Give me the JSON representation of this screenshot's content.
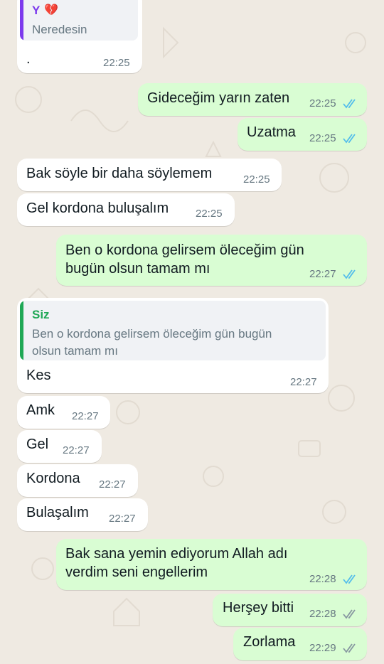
{
  "colors": {
    "chat_bg": "#efeae2",
    "incoming": "#ffffff",
    "outgoing": "#d9fdd3",
    "read_ticks": "#53bdeb",
    "delivered_ticks": "#8696a0",
    "quote_author_first": "#7c3aed",
    "quote_author_siz": "#1fa855"
  },
  "messages": [
    {
      "dir": "in",
      "quote": {
        "author": "Y",
        "emoji": "💔",
        "text": "Neredesin"
      },
      "text": ".",
      "time": "22:25"
    },
    {
      "dir": "out",
      "text": "Gideceğim yarın zaten",
      "time": "22:25",
      "status": "read"
    },
    {
      "dir": "out",
      "text": "Uzatma",
      "time": "22:25",
      "status": "read"
    },
    {
      "dir": "in",
      "text": "Bak söyle bir daha söylemem",
      "time": "22:25"
    },
    {
      "dir": "in",
      "text": "Gel kordona buluşalım",
      "time": "22:25"
    },
    {
      "dir": "out",
      "text_lines": [
        "Ben o kordona gelirsem öleceğim gün",
        "bugün olsun tamam mı"
      ],
      "time": "22:27",
      "status": "read"
    },
    {
      "dir": "in",
      "quote": {
        "author": "Siz",
        "text_lines": [
          "Ben o kordona gelirsem öleceğim gün bugün",
          "olsun tamam mı"
        ]
      },
      "text": "Kes",
      "time": "22:27"
    },
    {
      "dir": "in",
      "text": "Amk",
      "time": "22:27"
    },
    {
      "dir": "in",
      "text": "Gel",
      "time": "22:27"
    },
    {
      "dir": "in",
      "text": "Kordona",
      "time": "22:27"
    },
    {
      "dir": "in",
      "text": "Bulaşalım",
      "time": "22:27"
    },
    {
      "dir": "out",
      "text_lines": [
        "Bak sana yemin ediyorum Allah adı",
        "verdim seni engellerim"
      ],
      "time": "22:28",
      "status": "read"
    },
    {
      "dir": "out",
      "text": "Herşey bitti",
      "time": "22:28",
      "status": "delivered"
    },
    {
      "dir": "out",
      "text": "Zorlama",
      "time": "22:29",
      "status": "delivered"
    }
  ]
}
